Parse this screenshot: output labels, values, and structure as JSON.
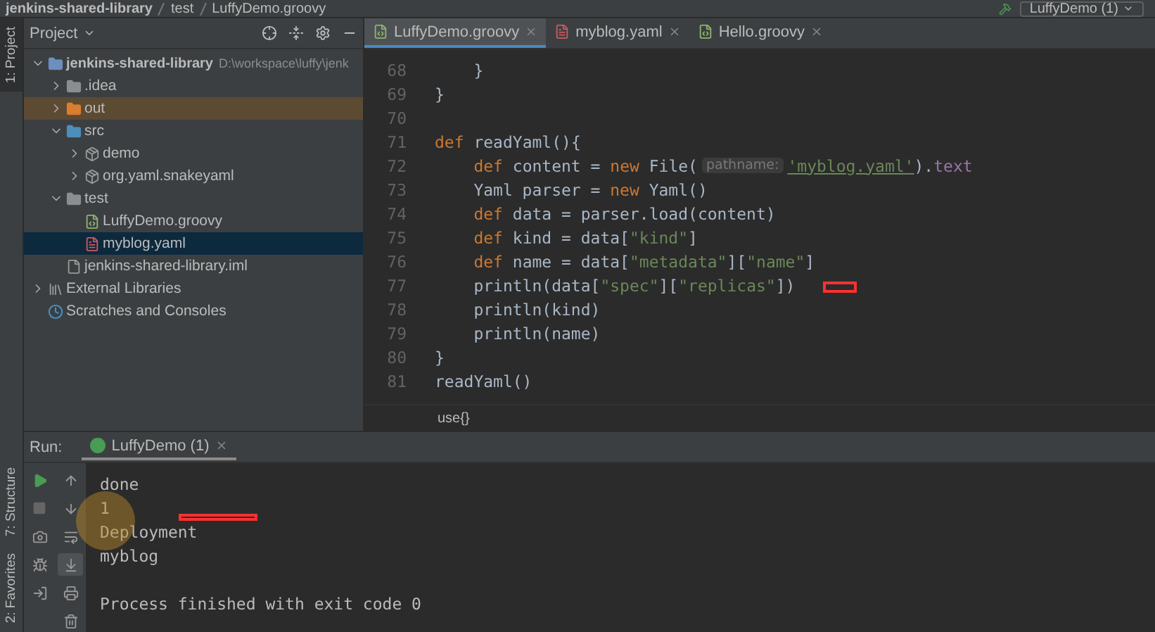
{
  "top_bar": {
    "breadcrumb": [
      "jenkins-shared-library",
      "test",
      "LuffyDemo.groovy"
    ],
    "run_config": "LuffyDemo (1)"
  },
  "tool_strip": {
    "top": [
      {
        "label": "1: Project",
        "selected": true
      }
    ],
    "bottom": [
      {
        "label": "7: Structure",
        "selected": false
      },
      {
        "label": "2: Favorites",
        "selected": false
      }
    ]
  },
  "project_panel": {
    "title": "Project",
    "tree": [
      {
        "label": "jenkins-shared-library",
        "path": "D:\\workspace\\luffy\\jenk",
        "kind": "module",
        "expanded": true,
        "selected": false,
        "hovered": false,
        "children": [
          {
            "label": ".idea",
            "kind": "folder",
            "expanded": false,
            "selected": false,
            "hovered": false
          },
          {
            "label": "out",
            "kind": "excluded-folder",
            "expanded": false,
            "selected": false,
            "hovered": true
          },
          {
            "label": "src",
            "kind": "source-folder",
            "expanded": true,
            "selected": false,
            "hovered": false,
            "children": [
              {
                "label": "demo",
                "kind": "package",
                "expanded": false,
                "selected": false,
                "hovered": false
              },
              {
                "label": "org.yaml.snakeyaml",
                "kind": "package",
                "expanded": false,
                "selected": false,
                "hovered": false
              }
            ]
          },
          {
            "label": "test",
            "kind": "folder",
            "expanded": true,
            "selected": false,
            "hovered": false,
            "children": [
              {
                "label": "LuffyDemo.groovy",
                "kind": "groovy",
                "selected": false,
                "hovered": false
              },
              {
                "label": "myblog.yaml",
                "kind": "yaml",
                "selected": true,
                "hovered": false
              }
            ]
          },
          {
            "label": "jenkins-shared-library.iml",
            "kind": "iml",
            "selected": false,
            "hovered": false
          }
        ]
      },
      {
        "label": "External Libraries",
        "kind": "libraries",
        "expanded": false,
        "selected": false,
        "hovered": false
      },
      {
        "label": "Scratches and Consoles",
        "kind": "scratches",
        "selected": false,
        "hovered": false
      }
    ]
  },
  "editor": {
    "tabs": [
      {
        "label": "LuffyDemo.groovy",
        "kind": "groovy",
        "selected": true
      },
      {
        "label": "myblog.yaml",
        "kind": "yaml",
        "selected": false
      },
      {
        "label": "Hello.groovy",
        "kind": "groovy",
        "selected": false
      }
    ],
    "lines": [
      {
        "number": "68",
        "tokens": [
          {
            "kind": "plain",
            "text": "    }"
          }
        ]
      },
      {
        "number": "69",
        "tokens": [
          {
            "kind": "plain",
            "text": "}"
          }
        ]
      },
      {
        "number": "70"
      },
      {
        "number": "71",
        "tokens": [
          {
            "kind": "kw",
            "text": "def"
          },
          {
            "kind": "plain",
            "text": " readYaml(){"
          }
        ]
      },
      {
        "number": "72",
        "tokens": [
          {
            "kind": "kw",
            "text": "    def"
          },
          {
            "kind": "plain",
            "text": " content = "
          },
          {
            "kind": "kw",
            "text": "new"
          },
          {
            "kind": "plain",
            "text": " File("
          },
          {
            "kind": "hint",
            "text": "pathname:"
          },
          {
            "kind": "str-link",
            "text": "'myblog.yaml'"
          },
          {
            "kind": "plain",
            "text": ")."
          },
          {
            "kind": "field",
            "text": "text"
          }
        ]
      },
      {
        "number": "73",
        "tokens": [
          {
            "kind": "plain",
            "text": "    Yaml parser = "
          },
          {
            "kind": "kw",
            "text": "new"
          },
          {
            "kind": "plain",
            "text": " Yaml()"
          }
        ]
      },
      {
        "number": "74",
        "tokens": [
          {
            "kind": "kw",
            "text": "    def"
          },
          {
            "kind": "plain",
            "text": " data = parser.load(content)"
          }
        ]
      },
      {
        "number": "75",
        "tokens": [
          {
            "kind": "kw",
            "text": "    def"
          },
          {
            "kind": "plain",
            "text": " kind = data["
          },
          {
            "kind": "str",
            "text": "\"kind\""
          },
          {
            "kind": "plain",
            "text": "]"
          }
        ]
      },
      {
        "number": "76",
        "tokens": [
          {
            "kind": "kw",
            "text": "    def"
          },
          {
            "kind": "plain",
            "text": " name = data["
          },
          {
            "kind": "str",
            "text": "\"metadata\""
          },
          {
            "kind": "plain",
            "text": "]["
          },
          {
            "kind": "str",
            "text": "\"name\""
          },
          {
            "kind": "plain",
            "text": "]"
          }
        ]
      },
      {
        "number": "77",
        "tokens": [
          {
            "kind": "plain",
            "text": "    println(data["
          },
          {
            "kind": "str",
            "text": "\"spec\""
          },
          {
            "kind": "plain",
            "text": "]["
          },
          {
            "kind": "str",
            "text": "\"replicas\""
          },
          {
            "kind": "plain",
            "text": "])"
          }
        ]
      },
      {
        "number": "78",
        "tokens": [
          {
            "kind": "plain",
            "text": "    println(kind)"
          }
        ]
      },
      {
        "number": "79",
        "tokens": [
          {
            "kind": "plain",
            "text": "    println(name)"
          }
        ]
      },
      {
        "number": "80",
        "tokens": [
          {
            "kind": "plain",
            "text": "}"
          }
        ]
      },
      {
        "number": "81",
        "tokens": [
          {
            "kind": "plain",
            "text": "readYaml()"
          }
        ]
      }
    ],
    "breadcrumb": "use{}"
  },
  "run": {
    "label": "Run:",
    "tab": {
      "label": "LuffyDemo (1)",
      "selected": true
    },
    "output": [
      "done",
      "1",
      "Deployment",
      "myblog"
    ],
    "exit_message": "Process finished with exit code 0"
  }
}
